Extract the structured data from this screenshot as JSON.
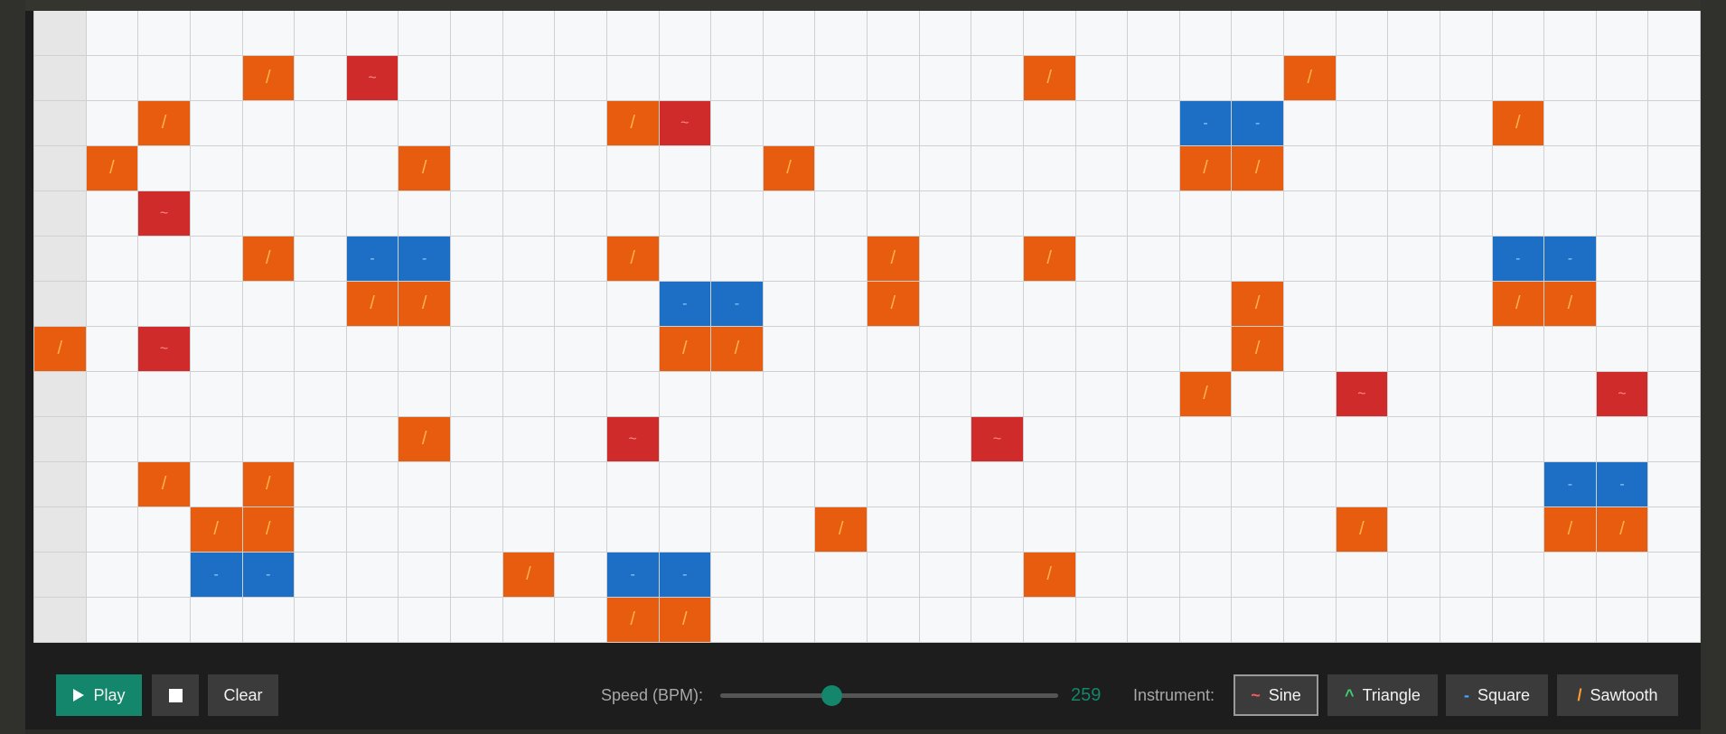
{
  "grid": {
    "rows": 14,
    "cols": 32,
    "glyphs": {
      "sine": "~",
      "tri": "^",
      "sq": "-",
      "saw": "/"
    },
    "notes": [
      {
        "r": 1,
        "c": 4,
        "t": "saw"
      },
      {
        "r": 1,
        "c": 6,
        "t": "sine"
      },
      {
        "r": 1,
        "c": 19,
        "t": "saw"
      },
      {
        "r": 1,
        "c": 24,
        "t": "saw"
      },
      {
        "r": 2,
        "c": 2,
        "t": "saw"
      },
      {
        "r": 2,
        "c": 11,
        "t": "saw"
      },
      {
        "r": 2,
        "c": 12,
        "t": "sine"
      },
      {
        "r": 2,
        "c": 22,
        "t": "sq"
      },
      {
        "r": 2,
        "c": 23,
        "t": "sq"
      },
      {
        "r": 2,
        "c": 28,
        "t": "saw"
      },
      {
        "r": 3,
        "c": 1,
        "t": "saw"
      },
      {
        "r": 3,
        "c": 7,
        "t": "saw"
      },
      {
        "r": 3,
        "c": 14,
        "t": "saw"
      },
      {
        "r": 3,
        "c": 22,
        "t": "saw"
      },
      {
        "r": 3,
        "c": 23,
        "t": "saw"
      },
      {
        "r": 4,
        "c": 2,
        "t": "sine"
      },
      {
        "r": 5,
        "c": 4,
        "t": "saw"
      },
      {
        "r": 5,
        "c": 6,
        "t": "sq"
      },
      {
        "r": 5,
        "c": 7,
        "t": "sq"
      },
      {
        "r": 5,
        "c": 11,
        "t": "saw"
      },
      {
        "r": 5,
        "c": 16,
        "t": "saw"
      },
      {
        "r": 5,
        "c": 19,
        "t": "saw"
      },
      {
        "r": 5,
        "c": 28,
        "t": "sq"
      },
      {
        "r": 5,
        "c": 29,
        "t": "sq"
      },
      {
        "r": 6,
        "c": 6,
        "t": "saw"
      },
      {
        "r": 6,
        "c": 7,
        "t": "saw"
      },
      {
        "r": 6,
        "c": 12,
        "t": "sq"
      },
      {
        "r": 6,
        "c": 13,
        "t": "sq"
      },
      {
        "r": 6,
        "c": 16,
        "t": "saw"
      },
      {
        "r": 6,
        "c": 23,
        "t": "saw"
      },
      {
        "r": 6,
        "c": 28,
        "t": "saw"
      },
      {
        "r": 6,
        "c": 29,
        "t": "saw"
      },
      {
        "r": 7,
        "c": 0,
        "t": "saw"
      },
      {
        "r": 7,
        "c": 2,
        "t": "sine"
      },
      {
        "r": 7,
        "c": 12,
        "t": "saw"
      },
      {
        "r": 7,
        "c": 13,
        "t": "saw"
      },
      {
        "r": 7,
        "c": 23,
        "t": "saw"
      },
      {
        "r": 8,
        "c": 22,
        "t": "saw"
      },
      {
        "r": 8,
        "c": 25,
        "t": "sine"
      },
      {
        "r": 8,
        "c": 30,
        "t": "sine"
      },
      {
        "r": 9,
        "c": 7,
        "t": "saw"
      },
      {
        "r": 9,
        "c": 11,
        "t": "sine"
      },
      {
        "r": 9,
        "c": 18,
        "t": "sine"
      },
      {
        "r": 10,
        "c": 2,
        "t": "saw"
      },
      {
        "r": 10,
        "c": 4,
        "t": "saw"
      },
      {
        "r": 10,
        "c": 29,
        "t": "sq"
      },
      {
        "r": 10,
        "c": 30,
        "t": "sq"
      },
      {
        "r": 11,
        "c": 3,
        "t": "saw"
      },
      {
        "r": 11,
        "c": 4,
        "t": "saw"
      },
      {
        "r": 11,
        "c": 15,
        "t": "saw"
      },
      {
        "r": 11,
        "c": 25,
        "t": "saw"
      },
      {
        "r": 11,
        "c": 29,
        "t": "saw"
      },
      {
        "r": 11,
        "c": 30,
        "t": "saw"
      },
      {
        "r": 12,
        "c": 3,
        "t": "sq"
      },
      {
        "r": 12,
        "c": 4,
        "t": "sq"
      },
      {
        "r": 12,
        "c": 9,
        "t": "saw"
      },
      {
        "r": 12,
        "c": 11,
        "t": "sq"
      },
      {
        "r": 12,
        "c": 12,
        "t": "sq"
      },
      {
        "r": 12,
        "c": 19,
        "t": "saw"
      },
      {
        "r": 13,
        "c": 11,
        "t": "saw"
      },
      {
        "r": 13,
        "c": 12,
        "t": "saw"
      }
    ]
  },
  "toolbar": {
    "play_label": "Play",
    "clear_label": "Clear",
    "speed_label": "Speed (BPM):",
    "speed_value": "259",
    "speed_fraction": 0.33,
    "instrument_label": "Instrument:",
    "instruments": [
      {
        "glyph": "~",
        "label": "Sine",
        "active": true
      },
      {
        "glyph": "^",
        "label": "Triangle",
        "active": false
      },
      {
        "glyph": "-",
        "label": "Square",
        "active": false
      },
      {
        "glyph": "/",
        "label": "Sawtooth",
        "active": false
      }
    ]
  }
}
